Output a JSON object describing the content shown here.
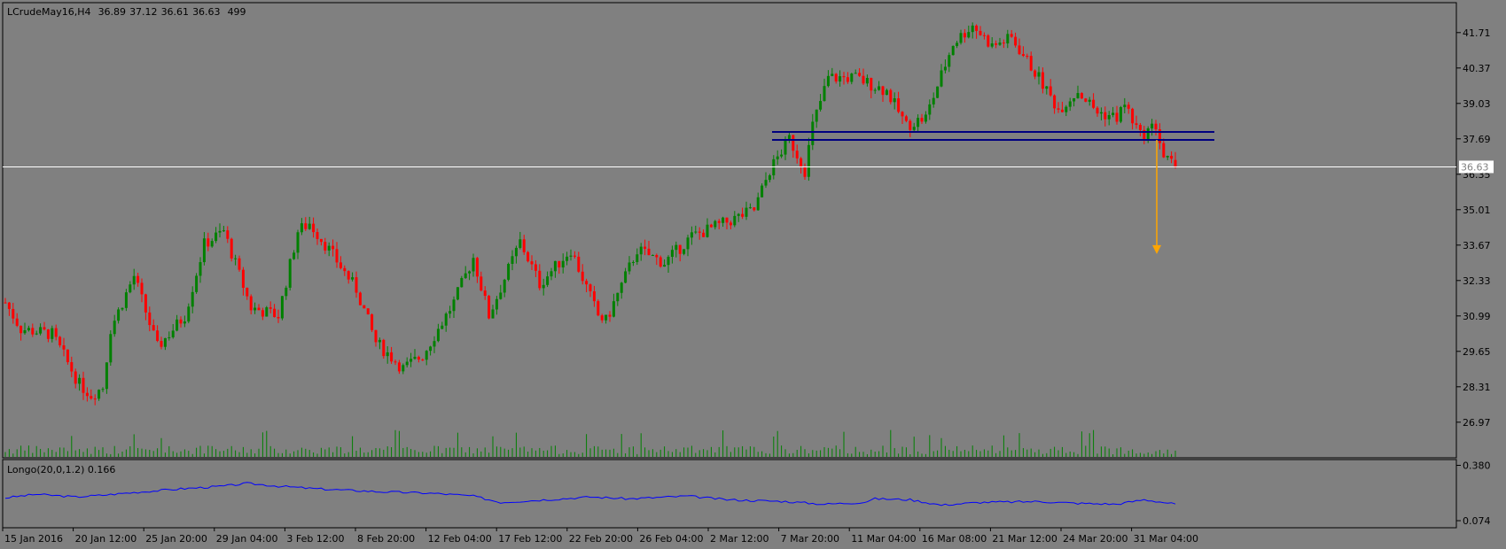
{
  "chart_data": {
    "type": "candlestick",
    "title": "LCrudeMay16,H4",
    "ohlc_header": {
      "open": "36.89",
      "high": "37.12",
      "low": "36.61",
      "close": "36.63",
      "bars": "499"
    },
    "current_price": "36.63",
    "price_ticks": [
      "41.71",
      "40.37",
      "39.03",
      "37.69",
      "36.35",
      "35.01",
      "33.67",
      "32.33",
      "30.99",
      "29.65",
      "28.31",
      "26.97"
    ],
    "ylim": [
      26.0,
      42.4
    ],
    "time_ticks": [
      "15 Jan 2016",
      "20 Jan 12:00",
      "25 Jan 20:00",
      "29 Jan 04:00",
      "3 Feb 12:00",
      "8 Feb 20:00",
      "12 Feb 04:00",
      "17 Feb 12:00",
      "22 Feb 20:00",
      "26 Feb 04:00",
      "2 Mar 12:00",
      "7 Mar 20:00",
      "11 Mar 04:00",
      "16 Mar 08:00",
      "21 Mar 12:00",
      "24 Mar 20:00",
      "31 Mar 04:00"
    ],
    "price_path": [
      [
        0,
        31.5
      ],
      [
        4,
        30.5
      ],
      [
        12,
        30.3
      ],
      [
        19,
        28.4
      ],
      [
        22,
        28.0
      ],
      [
        25,
        28.3
      ],
      [
        27,
        30.5
      ],
      [
        33,
        32.5
      ],
      [
        39,
        29.8
      ],
      [
        46,
        31.0
      ],
      [
        51,
        33.7
      ],
      [
        56,
        34.2
      ],
      [
        63,
        31.3
      ],
      [
        70,
        31.0
      ],
      [
        75,
        34.2
      ],
      [
        78,
        34.5
      ],
      [
        83,
        33.5
      ],
      [
        90,
        32.0
      ],
      [
        95,
        30.0
      ],
      [
        102,
        29.0
      ],
      [
        107,
        29.5
      ],
      [
        115,
        31.5
      ],
      [
        120,
        33.2
      ],
      [
        124,
        31.0
      ],
      [
        132,
        33.8
      ],
      [
        137,
        32.2
      ],
      [
        145,
        33.5
      ],
      [
        152,
        31.0
      ],
      [
        154,
        30.8
      ],
      [
        162,
        33.5
      ],
      [
        169,
        33.0
      ],
      [
        176,
        34.0
      ],
      [
        186,
        34.6
      ],
      [
        192,
        35.0
      ],
      [
        196,
        36.5
      ],
      [
        201,
        37.7
      ],
      [
        205,
        36.5
      ],
      [
        207,
        38.2
      ],
      [
        211,
        40.0
      ],
      [
        218,
        40.0
      ],
      [
        226,
        39.5
      ],
      [
        231,
        38.2
      ],
      [
        236,
        38.5
      ],
      [
        243,
        41.3
      ],
      [
        248,
        42.0
      ],
      [
        253,
        41.2
      ],
      [
        258,
        41.5
      ],
      [
        265,
        40.0
      ],
      [
        270,
        38.8
      ],
      [
        275,
        39.5
      ],
      [
        280,
        38.7
      ],
      [
        285,
        38.5
      ],
      [
        287,
        39.0
      ],
      [
        291,
        37.8
      ],
      [
        295,
        38.2
      ],
      [
        297,
        37.0
      ],
      [
        300,
        36.63
      ]
    ],
    "support_zone": [
      37.65,
      37.95
    ],
    "target_arrow": {
      "from": 37.65,
      "to": 33.4
    },
    "indicator": {
      "label": "Longo(20,0,1.2) 0.166",
      "ticks": [
        "0.380",
        "0.074"
      ],
      "ylim": [
        0.074,
        0.38
      ],
      "path": [
        [
          0,
          0.2
        ],
        [
          8,
          0.22
        ],
        [
          18,
          0.205
        ],
        [
          25,
          0.215
        ],
        [
          33,
          0.23
        ],
        [
          45,
          0.25
        ],
        [
          56,
          0.265
        ],
        [
          62,
          0.28
        ],
        [
          70,
          0.265
        ],
        [
          80,
          0.25
        ],
        [
          95,
          0.235
        ],
        [
          110,
          0.225
        ],
        [
          120,
          0.21
        ],
        [
          127,
          0.175
        ],
        [
          135,
          0.185
        ],
        [
          150,
          0.205
        ],
        [
          160,
          0.195
        ],
        [
          175,
          0.21
        ],
        [
          185,
          0.19
        ],
        [
          200,
          0.18
        ],
        [
          210,
          0.165
        ],
        [
          220,
          0.175
        ],
        [
          223,
          0.195
        ],
        [
          232,
          0.19
        ],
        [
          240,
          0.16
        ],
        [
          250,
          0.175
        ],
        [
          265,
          0.18
        ],
        [
          275,
          0.17
        ],
        [
          285,
          0.165
        ],
        [
          292,
          0.19
        ],
        [
          300,
          0.166
        ]
      ]
    },
    "colors": {
      "bull": "#008000",
      "bear": "#ff0000",
      "zone": "#000080",
      "arrow": "#ffa500",
      "price_line": "#ffffff",
      "indicator": "#0000ff"
    }
  }
}
